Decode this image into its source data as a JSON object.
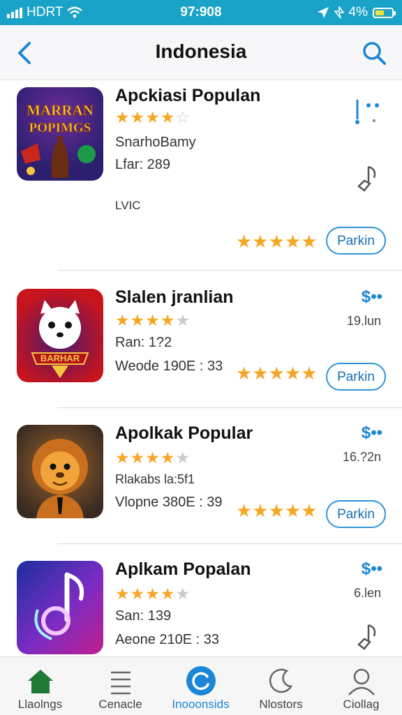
{
  "status_bar": {
    "carrier": "HDRT",
    "time": "97:908",
    "battery": "4%"
  },
  "nav": {
    "title": "Indonesia"
  },
  "apps": [
    {
      "name": "Apckiasi Populan",
      "icon_text": "MARRAN POPIMGS",
      "subtitle": "SnarhoBamy",
      "line2": "Lfar: 289",
      "line3": "LVIC",
      "price": "",
      "size": "",
      "button": "Parkin",
      "colors": {
        "a": "#2c1f6e",
        "b": "#6a2d9a"
      }
    },
    {
      "name": "Slalen jranlian",
      "icon_text": "BARHAR",
      "subtitle": "",
      "line2": "Ran: 1?2",
      "line3": "Weode 190E : 33",
      "price": "$••",
      "size": "19.lun",
      "button": "Parkin",
      "colors": {
        "a": "#c8141d",
        "b": "#4b1a6e"
      }
    },
    {
      "name": "Apolkak Popular",
      "icon_text": "",
      "subtitle": "",
      "line2": "Rlakabs la:5f1",
      "line3": "Vlopne 380E : 39",
      "price": "$••",
      "size": "16.?2n",
      "button": "Parkin",
      "colors": {
        "a": "#3a2b22",
        "b": "#a0662c"
      }
    },
    {
      "name": "Aplkam Popalan",
      "icon_text": "",
      "subtitle": "",
      "line2": "San: 139",
      "line3": "Aeone 210E : 33",
      "price": "$••",
      "size": "6.len",
      "button": "",
      "colors": {
        "a": "#1b2f9e",
        "b": "#c01e8a"
      }
    }
  ],
  "tabs": [
    {
      "label": "Llaolngs",
      "icon": "home-icon"
    },
    {
      "label": "Cenacle",
      "icon": "list-icon"
    },
    {
      "label": "Inooonsids",
      "icon": "refresh-icon"
    },
    {
      "label": "Nlostors",
      "icon": "moon-icon"
    },
    {
      "label": "Ciollag",
      "icon": "person-icon"
    }
  ],
  "accent": "#1b86d6",
  "star_color": "#f5a623"
}
